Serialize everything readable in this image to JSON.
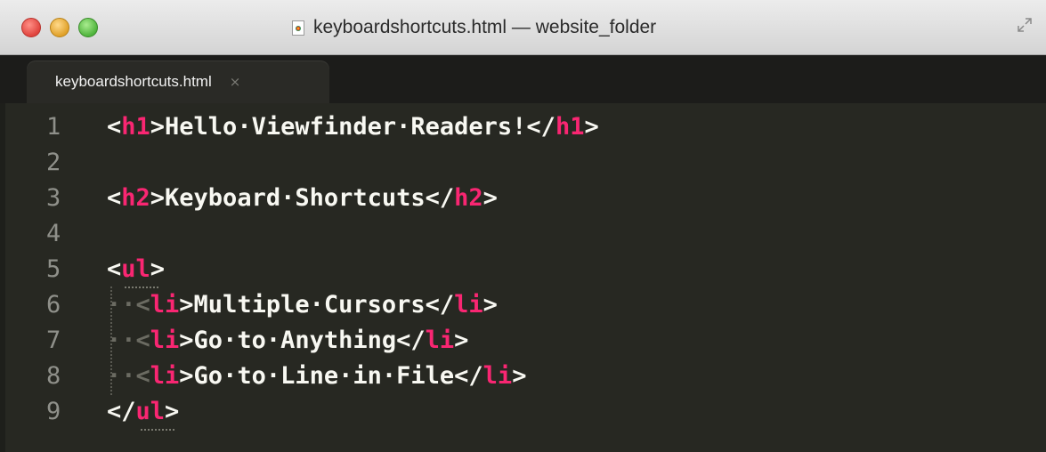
{
  "window": {
    "title": "keyboardshortcuts.html — website_folder"
  },
  "tabs": [
    {
      "label": "keyboardshortcuts.html",
      "close": "×"
    }
  ],
  "editor": {
    "lines": [
      {
        "number": "1",
        "open": "<",
        "tag": "h1",
        "mid": ">Hello·Viewfinder·Readers!</",
        "tag2": "h1",
        "close": ">"
      },
      {
        "number": "2"
      },
      {
        "number": "3",
        "open": "<",
        "tag": "h2",
        "mid": ">Keyboard·Shortcuts</",
        "tag2": "h2",
        "close": ">"
      },
      {
        "number": "4"
      },
      {
        "number": "5",
        "open": "<",
        "tag": "ul",
        "close": ">"
      },
      {
        "number": "6",
        "lead": "··<",
        "tag": "li",
        "mid": ">Multiple·Cursors</",
        "tag2": "li",
        "close": ">"
      },
      {
        "number": "7",
        "lead": "··<",
        "tag": "li",
        "mid": ">Go·to·Anything</",
        "tag2": "li",
        "close": ">"
      },
      {
        "number": "8",
        "lead": "··<",
        "tag": "li",
        "mid": ">Go·to·Line·in·File</",
        "tag2": "li",
        "close": ">"
      },
      {
        "number": "9",
        "open": "</",
        "tag": "ul",
        "close": ">"
      }
    ]
  },
  "colors": {
    "background": "#272822",
    "text": "#f8f8f2",
    "tag": "#f92672",
    "line_number": "#8f908a"
  }
}
